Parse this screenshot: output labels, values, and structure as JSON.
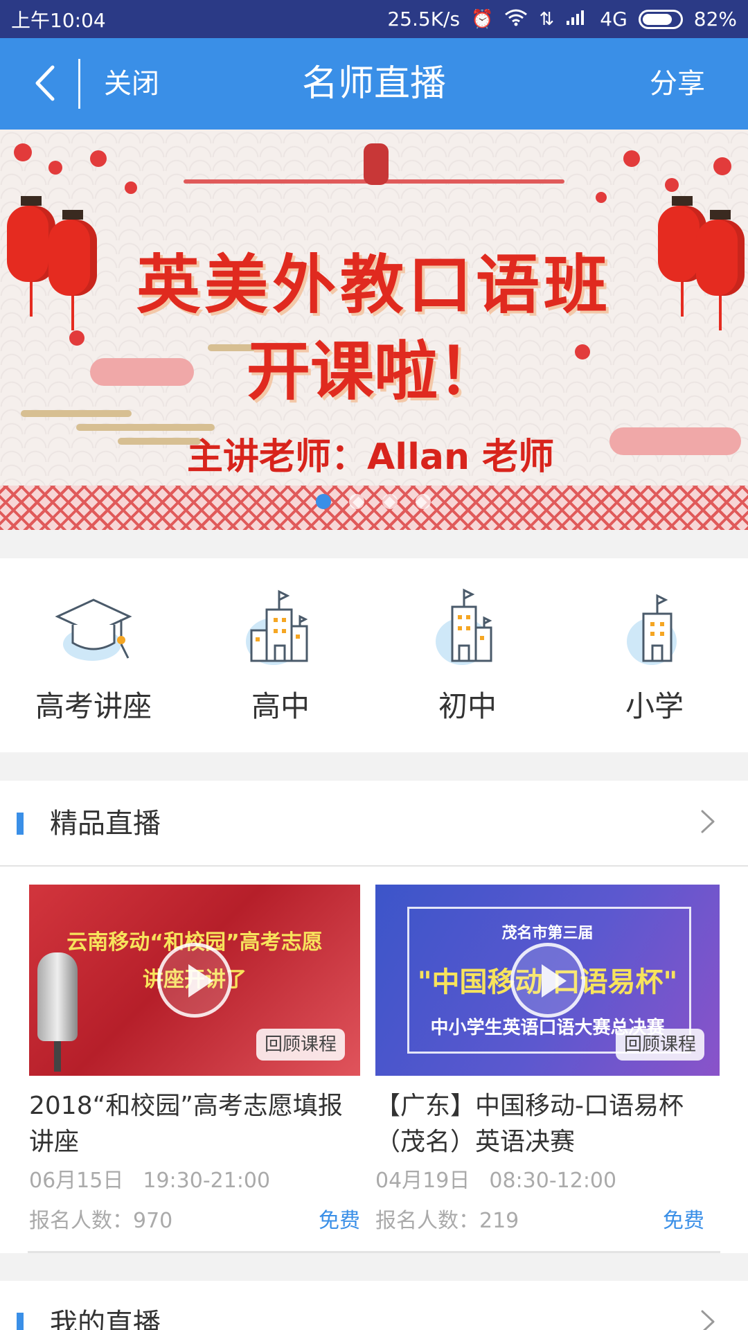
{
  "status_bar": {
    "time": "上午10:04",
    "speed": "25.5K/s",
    "network": "4G",
    "battery": "82%"
  },
  "app_bar": {
    "close": "关闭",
    "title": "名师直播",
    "share": "分享"
  },
  "banner": {
    "title": "英美外教口语班",
    "subtitle": "开课啦！",
    "teacher": "主讲老师：Allan 老师",
    "slide_count": 4,
    "active_slide": 1
  },
  "categories": [
    {
      "label": "高考讲座",
      "icon": "graduation-cap-icon"
    },
    {
      "label": "高中",
      "icon": "school-buildings-icon"
    },
    {
      "label": "初中",
      "icon": "school-building-icon"
    },
    {
      "label": "小学",
      "icon": "small-school-icon"
    }
  ],
  "featured": {
    "title": "精品直播",
    "cards": [
      {
        "thumb_headline_1": "云南移动“和校园”高考志愿",
        "thumb_headline_2": "讲座开讲了",
        "badge": "回顾课程",
        "title": "2018“和校园”高考志愿填报讲座",
        "date": "06月15日",
        "time": "19:30-21:00",
        "count_label": "报名人数：970",
        "price": "免费"
      },
      {
        "thumb_small": "茂名市第三届",
        "thumb_headline_1": "\"中国移动 口语易杯\"",
        "thumb_headline_2": "中小学生英语口语大赛总决赛",
        "badge": "回顾课程",
        "title": "【广东】中国移动-口语易杯（茂名）英语决赛",
        "date": "04月19日",
        "time": "08:30-12:00",
        "count_label": "报名人数：219",
        "price": "免费"
      }
    ]
  },
  "my_live": {
    "title": "我的直播"
  }
}
